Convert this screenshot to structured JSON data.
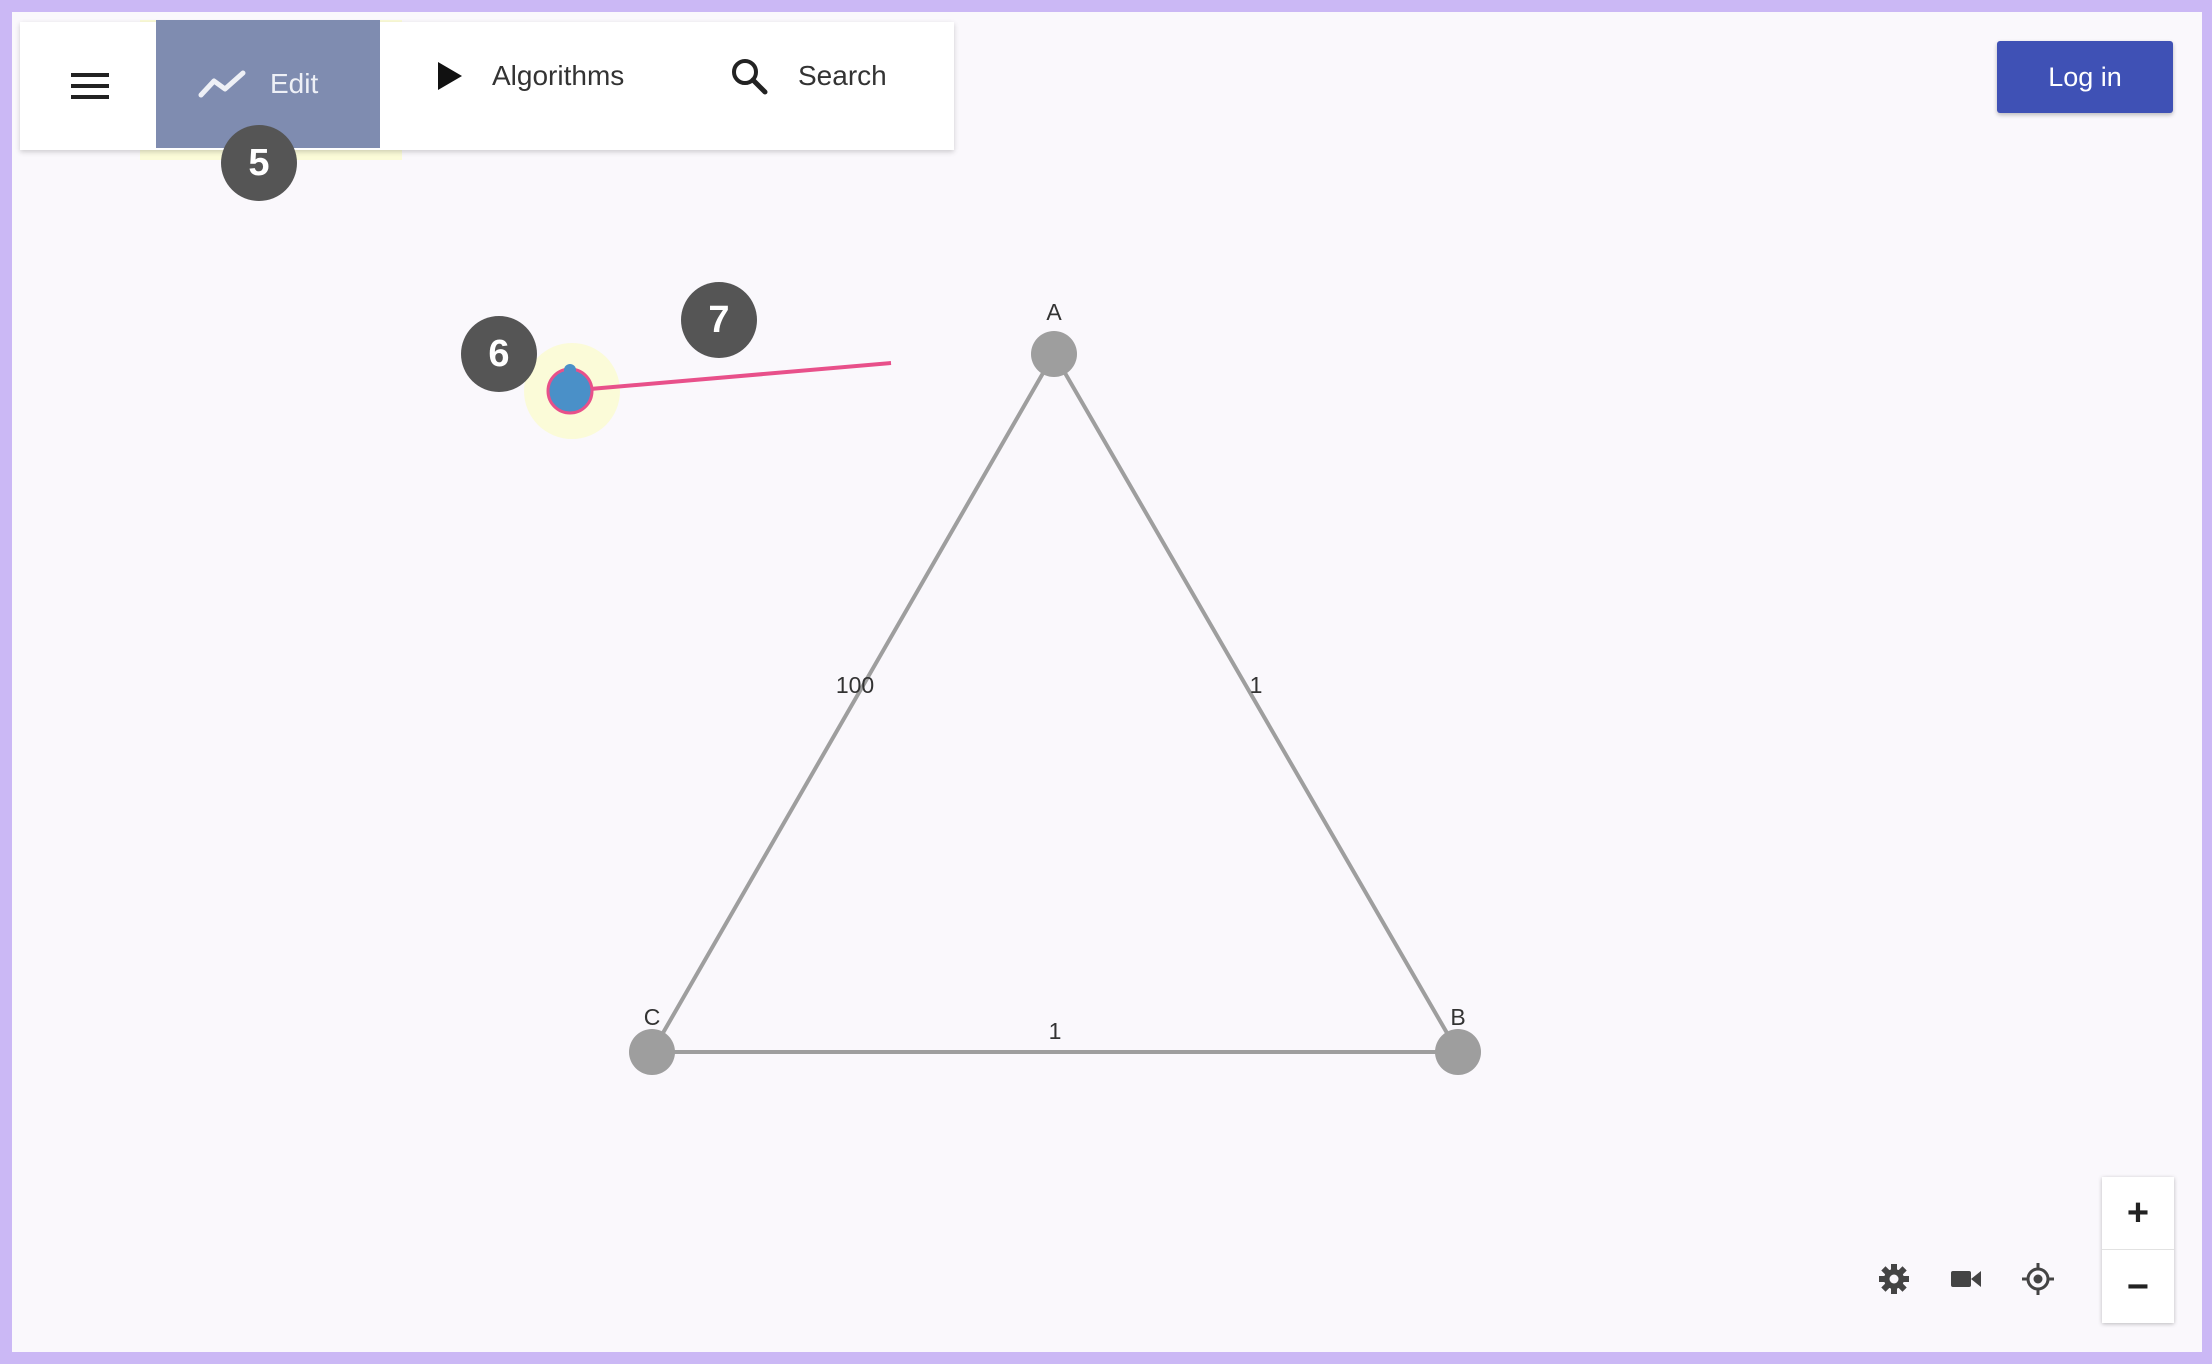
{
  "toolbar": {
    "menu_icon": "hamburger-menu-icon",
    "edit_label": "Edit",
    "edit_icon": "line-chart-icon",
    "algorithms_label": "Algorithms",
    "algorithms_icon": "play-icon",
    "search_label": "Search",
    "search_icon": "search-icon"
  },
  "login_label": "Log in",
  "badges": {
    "edit_step": "5",
    "node_step": "6",
    "edge_step": "7"
  },
  "graph": {
    "nodes": [
      {
        "id": "A",
        "label": "A"
      },
      {
        "id": "B",
        "label": "B"
      },
      {
        "id": "C",
        "label": "C"
      }
    ],
    "edges": [
      {
        "from": "A",
        "to": "C",
        "weight": "100"
      },
      {
        "from": "A",
        "to": "B",
        "weight": "1"
      },
      {
        "from": "C",
        "to": "B",
        "weight": "1"
      }
    ],
    "node_color": "#9e9e9e",
    "edge_color": "#9e9e9e",
    "new_node_color": "#4a90c8",
    "new_edge_color": "#e8508a"
  },
  "controls": {
    "zoom_in": "+",
    "zoom_out": "−",
    "settings_icon": "gear-icon",
    "camera_icon": "video-camera-icon",
    "locate_icon": "crosshair-locate-icon"
  },
  "colors": {
    "accent": "#3f51b5",
    "edit_active": "#7f8cb0",
    "badge": "#555555",
    "border": "#cbb8f5"
  }
}
